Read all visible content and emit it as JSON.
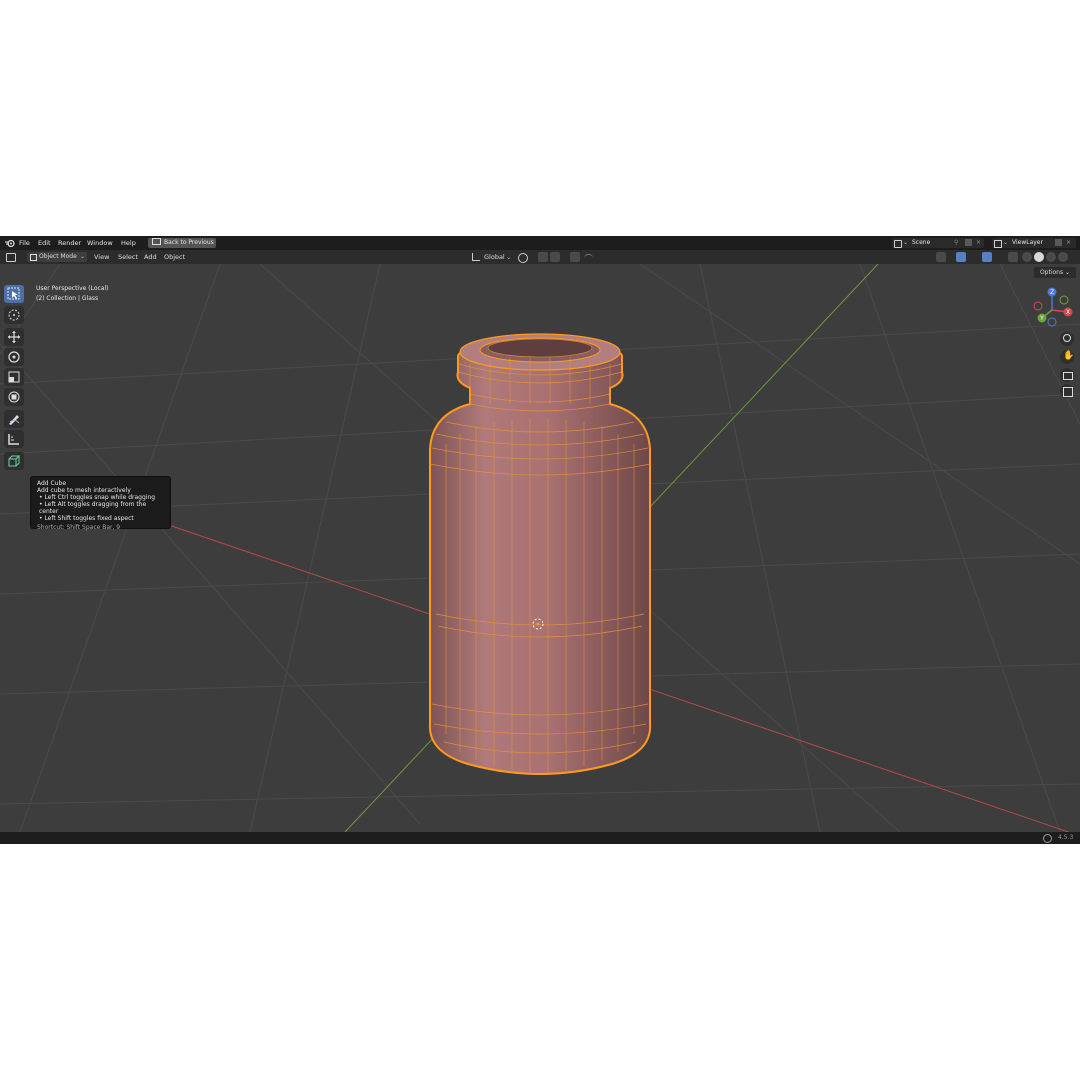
{
  "topbar": {
    "menus": [
      "File",
      "Edit",
      "Render",
      "Window",
      "Help"
    ],
    "back_button": "Back to Previous",
    "scene": "Scene",
    "view_layer": "ViewLayer"
  },
  "header": {
    "mode": "Object Mode",
    "menus": [
      "View",
      "Select",
      "Add",
      "Object"
    ],
    "transform_orientation": "Global",
    "options": "Options"
  },
  "viewport": {
    "perspective": "User Perspective (Local)",
    "collection": "(2) Collection | Glass",
    "object_color": "#b07878",
    "selection_color": "#ff9a1f",
    "grid_color": "#4a4a4a",
    "x_axis_color": "#b34a4a",
    "y_axis_color": "#6e9a3a"
  },
  "gizmo": {
    "x": "X",
    "y": "Y",
    "z": "Z"
  },
  "tooltip": {
    "title": "Add Cube",
    "description": "Add cube to mesh interactively",
    "hints": [
      "• Left Ctrl toggles snap while dragging",
      "• Left Alt toggles dragging from the center",
      "• Left Shift toggles fixed aspect"
    ],
    "shortcut": "Shortcut: Shift Space Bar, 9"
  },
  "toolbar": {
    "tools": [
      "select-box",
      "cursor",
      "move",
      "rotate",
      "scale",
      "transform",
      "annotate",
      "measure",
      "add-cube"
    ],
    "active": "select-box"
  },
  "status": {
    "version": "4.5.3"
  }
}
